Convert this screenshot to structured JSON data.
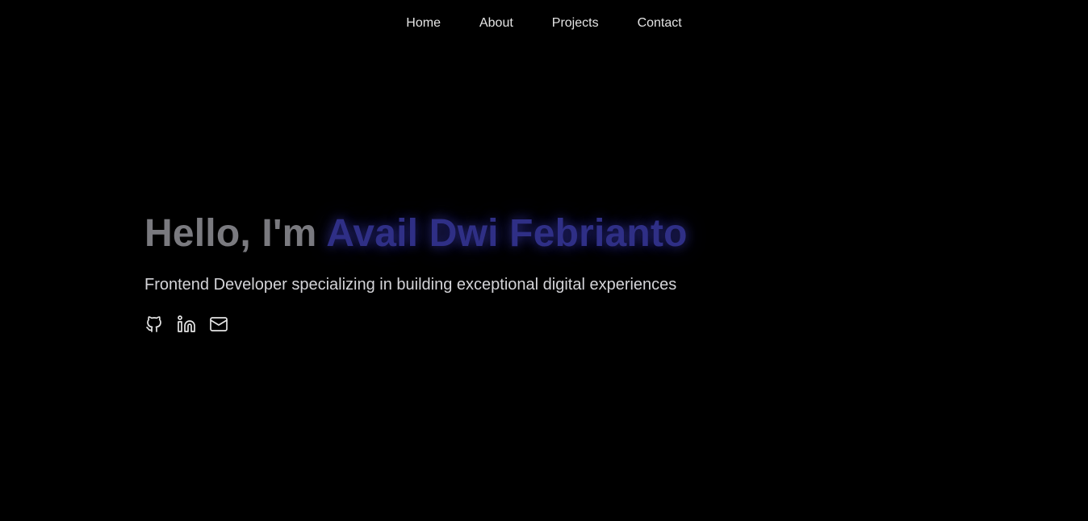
{
  "nav": {
    "items": [
      {
        "label": "Home"
      },
      {
        "label": "About"
      },
      {
        "label": "Projects"
      },
      {
        "label": "Contact"
      }
    ]
  },
  "hero": {
    "greeting": "Hello, I'm",
    "name": "Avail Dwi Febrianto",
    "tagline": "Frontend Developer specializing in building exceptional digital experiences",
    "socials": [
      {
        "icon": "github-icon"
      },
      {
        "icon": "linkedin-icon"
      },
      {
        "icon": "mail-icon"
      }
    ]
  },
  "colors": {
    "background": "#000000",
    "greeting": "#7a7a7f",
    "accent": "#2f2f86",
    "nav_text": "#e5e5e5",
    "tagline": "#d4d4d8"
  }
}
